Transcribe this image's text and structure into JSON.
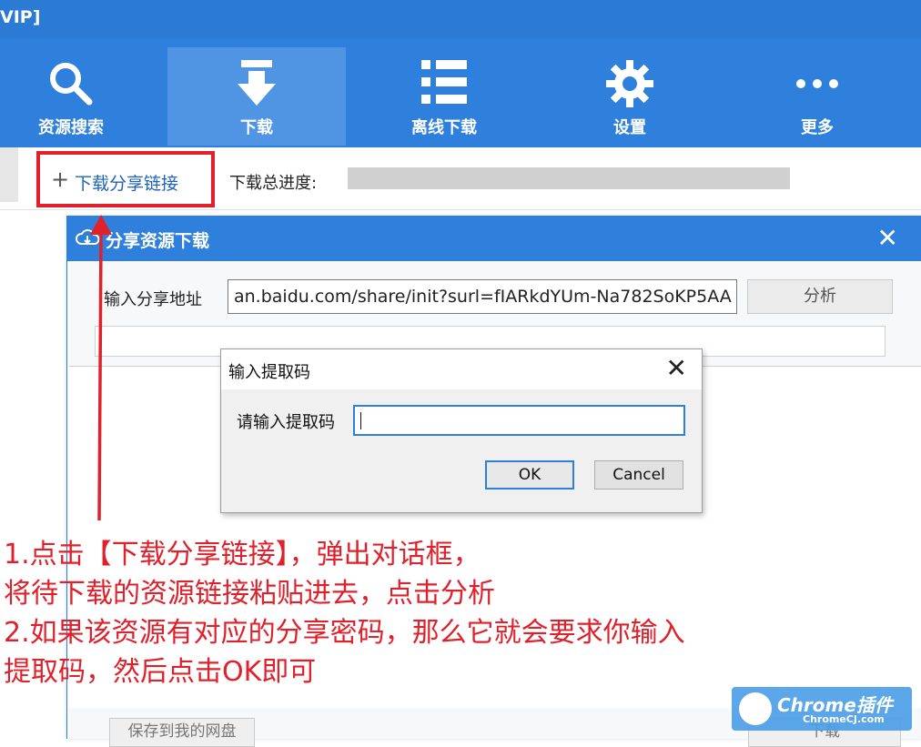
{
  "window": {
    "title_fragment": "VIP]"
  },
  "toolbar": {
    "items": [
      {
        "label": "资源搜索",
        "icon": "search-icon"
      },
      {
        "label": "下载",
        "icon": "download-icon"
      },
      {
        "label": "离线下载",
        "icon": "list-icon"
      },
      {
        "label": "设置",
        "icon": "gear-icon"
      },
      {
        "label": "更多",
        "icon": "more-icon"
      }
    ],
    "active_index": 1
  },
  "subbar": {
    "add_link_label": "下载分享链接",
    "progress_label": "下载总进度:"
  },
  "share_dialog": {
    "title": "分享资源下载",
    "url_label": "输入分享地址",
    "url_value": "an.baidu.com/share/init?surl=fIARkdYUm-Na782SoKP5AA",
    "analyze_button": "分析",
    "save_button": "保存到我的网盘",
    "download_button": "下载"
  },
  "code_prompt": {
    "title": "输入提取码",
    "field_label": "请输入提取码",
    "field_value": "",
    "ok_button": "OK",
    "cancel_button": "Cancel"
  },
  "annotation": {
    "lines": [
      "1.点击【下载分享链接】，弹出对话框，",
      "将待下载的资源链接粘贴进去，点击分析",
      "2.如果该资源有对应的分享密码，那么它就会要求你输入",
      "提取码，然后点击OK即可"
    ],
    "color": "#e0202a"
  },
  "watermark": {
    "brand": "Chrome插件",
    "site": "ChromeCJ.com"
  },
  "colors": {
    "toolbar_blue": "#2f80dc",
    "highlight_red": "#e0202a"
  }
}
